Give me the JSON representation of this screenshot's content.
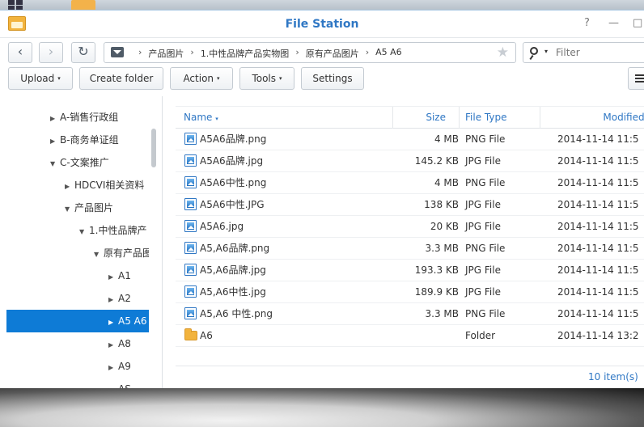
{
  "window": {
    "title": "File Station",
    "help_label": "?",
    "minimize_label": "—",
    "maximize_label": "□"
  },
  "navbar": {
    "back_label": "‹",
    "forward_label": "›",
    "refresh_label": "↻",
    "breadcrumbs": [
      "产品图片",
      "1.中性品牌产品实物图",
      "原有产品图片",
      "A5 A6"
    ],
    "breadcrumb_separator": "›",
    "star_label": "★",
    "filter_placeholder": "Filter",
    "filter_caret": "▾"
  },
  "toolbar": {
    "upload_label": "Upload",
    "create_folder_label": "Create folder",
    "action_label": "Action",
    "tools_label": "Tools",
    "settings_label": "Settings",
    "caret": "▾"
  },
  "sidebar": {
    "items": [
      {
        "label": "A-销售行政组",
        "arrow": "▶"
      },
      {
        "label": "B-商务单证组",
        "arrow": "▶"
      },
      {
        "label": "C-文案推广",
        "arrow": "▼"
      },
      {
        "label": "HDCVI相关资料",
        "arrow": "▶"
      },
      {
        "label": "产品图片",
        "arrow": "▼"
      },
      {
        "label": "1.中性品牌产",
        "arrow": "▼"
      },
      {
        "label": "原有产品图",
        "arrow": "▼"
      },
      {
        "label": "A1",
        "arrow": "▶"
      },
      {
        "label": "A2",
        "arrow": "▶"
      },
      {
        "label": "A5 A6",
        "arrow": "▶"
      },
      {
        "label": "A8",
        "arrow": "▶"
      },
      {
        "label": "A9",
        "arrow": "▶"
      },
      {
        "label": "AS",
        "arrow": "▶"
      }
    ]
  },
  "filelist": {
    "columns": {
      "name": "Name",
      "size": "Size",
      "type": "File Type",
      "modified": "Modified Da",
      "sort_caret": "▾"
    },
    "rows": [
      {
        "name": "A5A6品牌.png",
        "size": "4 MB",
        "type": "PNG File",
        "modified": "2014-11-14 11:5",
        "icon": "image-icon"
      },
      {
        "name": "A5A6品牌.jpg",
        "size": "145.2 KB",
        "type": "JPG File",
        "modified": "2014-11-14 11:5",
        "icon": "image-icon"
      },
      {
        "name": "A5A6中性.png",
        "size": "4 MB",
        "type": "PNG File",
        "modified": "2014-11-14 11:5",
        "icon": "image-icon"
      },
      {
        "name": "A5A6中性.JPG",
        "size": "138 KB",
        "type": "JPG File",
        "modified": "2014-11-14 11:5",
        "icon": "image-icon"
      },
      {
        "name": "A5A6.jpg",
        "size": "20 KB",
        "type": "JPG File",
        "modified": "2014-11-14 11:5",
        "icon": "image-icon"
      },
      {
        "name": "A5,A6品牌.png",
        "size": "3.3 MB",
        "type": "PNG File",
        "modified": "2014-11-14 11:5",
        "icon": "image-icon"
      },
      {
        "name": "A5,A6品牌.jpg",
        "size": "193.3 KB",
        "type": "JPG File",
        "modified": "2014-11-14 11:5",
        "icon": "image-icon"
      },
      {
        "name": "A5,A6中性.jpg",
        "size": "189.9 KB",
        "type": "JPG File",
        "modified": "2014-11-14 11:5",
        "icon": "image-icon"
      },
      {
        "name": "A5,A6 中性.png",
        "size": "3.3 MB",
        "type": "PNG File",
        "modified": "2014-11-14 11:5",
        "icon": "image-icon"
      },
      {
        "name": "A6",
        "size": "",
        "type": "Folder",
        "modified": "2014-11-14 13:2",
        "icon": "folder-icon"
      }
    ],
    "item_count": "10 item(s)"
  },
  "colors": {
    "accent": "#2f77c4",
    "selection": "#0e7bd6",
    "folder": "#f2b33d"
  }
}
